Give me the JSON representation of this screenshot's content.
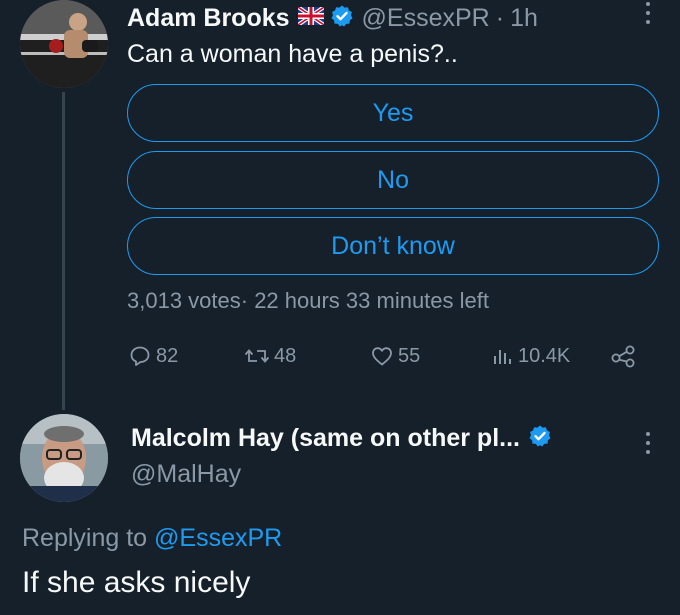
{
  "colors": {
    "background": "#15202b",
    "text_primary": "#f7f9f9",
    "text_secondary": "#8b98a5",
    "accent": "#1d9bf0",
    "verified": "#1d9bf0",
    "thread_line": "#38444d"
  },
  "tweet": {
    "author_name": "Adam Brooks",
    "handle": "@EssexPR",
    "separator": "·",
    "time": "1h",
    "text": "Can a woman have a penis?..",
    "flag_icon": "uk-flag-icon",
    "verified_icon": "verified-badge-icon",
    "poll": {
      "options": [
        "Yes",
        "No",
        "Don’t know"
      ],
      "meta": "3,013 votes· 22 hours 33 minutes left"
    },
    "actions": {
      "replies": "82",
      "retweets": "48",
      "likes": "55",
      "views": "10.4K"
    }
  },
  "reply": {
    "author_name": "Malcolm Hay (same on other pl...",
    "handle": "@MalHay",
    "replying_prefix": "Replying to",
    "replying_to": "@EssexPR",
    "text": "If she asks nicely"
  }
}
